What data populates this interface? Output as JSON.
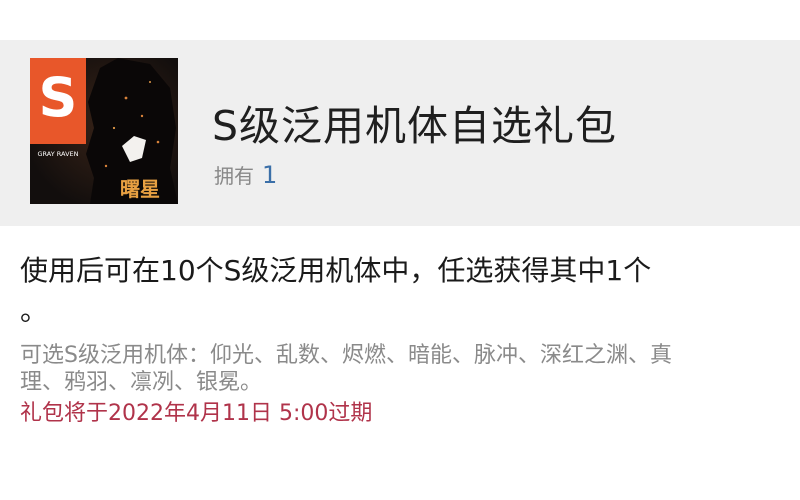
{
  "item": {
    "title": "S级泛用机体自选礼包",
    "owned_label": "拥有",
    "owned_count": "1",
    "icon": {
      "name": "gift-pack-icon",
      "logo_text": "GRAY RAVEN",
      "corner_text": "曙星",
      "logo_letter": "S",
      "colors": {
        "logo_orange": "#e8572a",
        "background": "#151111",
        "corner_text": "#e8a042"
      }
    }
  },
  "description": {
    "main_line1": "使用后可在10个S级泛用机体中，任选获得其中1个",
    "main_line2": "。",
    "options": "可选S级泛用机体：仰光、乱数、烬燃、暗能、脉冲、深红之渊、真理、鸦羽、凛冽、银冕。",
    "expire": "礼包将于2022年4月11日 5:00过期"
  },
  "colors": {
    "header_bg": "#efefef",
    "title_text": "#1f1f1f",
    "count_blue": "#3b6fa8",
    "expire_red": "#b0334a",
    "secondary_gray": "#8a8a8a"
  }
}
